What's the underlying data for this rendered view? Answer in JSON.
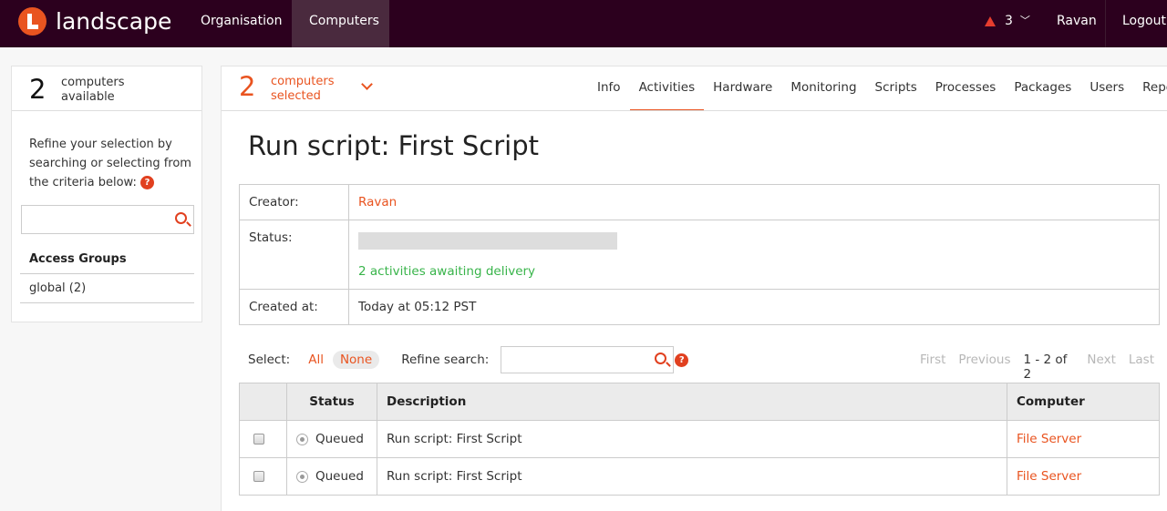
{
  "header": {
    "brand": "landscape",
    "nav": {
      "organisation": "Organisation",
      "computers": "Computers"
    },
    "alert_count": "3",
    "user": "Ravan",
    "logout": "Logout",
    "accent": "#e95420",
    "bar_color": "#2c001e"
  },
  "sidebar": {
    "count": "2",
    "count_label_1": "computers",
    "count_label_2": "available",
    "description": "Refine your selection by searching or selecting from the criteria below:",
    "help": "?",
    "search_placeholder": "",
    "access_groups_title": "Access Groups",
    "access_groups": [
      "global (2)"
    ]
  },
  "selection": {
    "count": "2",
    "label_1": "computers",
    "label_2": "selected"
  },
  "tabs": [
    "Info",
    "Activities",
    "Hardware",
    "Monitoring",
    "Scripts",
    "Processes",
    "Packages",
    "Users",
    "Reports"
  ],
  "active_tab": "Activities",
  "page": {
    "title": "Run script: First Script",
    "creator_label": "Creator:",
    "creator": "Ravan",
    "status_label": "Status:",
    "status_progress": 0,
    "status_text": "2 activities awaiting delivery",
    "created_label": "Created at:",
    "created": "Today at 05:12 PST"
  },
  "controls": {
    "select_label": "Select:",
    "all": "All",
    "none": "None",
    "refine_label": "Refine search:",
    "refine_placeholder": "",
    "help": "?"
  },
  "pager": {
    "first": "First",
    "previous": "Previous",
    "range": "1 - 2 of 2",
    "next": "Next",
    "last": "Last"
  },
  "table": {
    "headers": {
      "status": "Status",
      "description": "Description",
      "computer": "Computer"
    },
    "rows": [
      {
        "status": "Queued",
        "description": "Run script: First Script",
        "computer": "File Server"
      },
      {
        "status": "Queued",
        "description": "Run script: First Script",
        "computer": "File Server"
      }
    ]
  }
}
